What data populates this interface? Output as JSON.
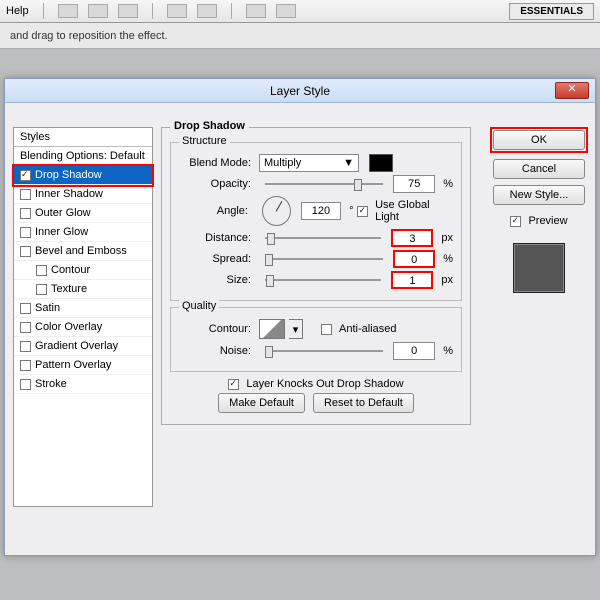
{
  "menubar": {
    "help": "Help"
  },
  "essentials_label": "ESSENTIALS",
  "optionsbar_hint": "and drag to reposition the effect.",
  "dialog": {
    "title": "Layer Style",
    "close_glyph": "✕"
  },
  "styles": {
    "header": "Styles",
    "blending": "Blending Options: Default",
    "items": [
      {
        "label": "Drop Shadow",
        "checked": true,
        "selected": true
      },
      {
        "label": "Inner Shadow",
        "checked": false
      },
      {
        "label": "Outer Glow",
        "checked": false
      },
      {
        "label": "Inner Glow",
        "checked": false
      },
      {
        "label": "Bevel and Emboss",
        "checked": false
      },
      {
        "label": "Contour",
        "checked": false,
        "sub": true
      },
      {
        "label": "Texture",
        "checked": false,
        "sub": true
      },
      {
        "label": "Satin",
        "checked": false
      },
      {
        "label": "Color Overlay",
        "checked": false
      },
      {
        "label": "Gradient Overlay",
        "checked": false
      },
      {
        "label": "Pattern Overlay",
        "checked": false
      },
      {
        "label": "Stroke",
        "checked": false
      }
    ]
  },
  "panel": {
    "group_label": "Drop Shadow",
    "structure": {
      "label": "Structure",
      "blend_mode_label": "Blend Mode:",
      "blend_mode_value": "Multiply",
      "opacity_label": "Opacity:",
      "opacity_value": "75",
      "angle_label": "Angle:",
      "angle_value": "120",
      "angle_unit": "°",
      "use_global_label": "Use Global Light",
      "distance_label": "Distance:",
      "distance_value": "3",
      "spread_label": "Spread:",
      "spread_value": "0",
      "size_label": "Size:",
      "size_value": "1",
      "px": "px",
      "pct": "%"
    },
    "quality": {
      "label": "Quality",
      "contour_label": "Contour:",
      "anti_aliased_label": "Anti-aliased",
      "noise_label": "Noise:",
      "noise_value": "0",
      "pct": "%"
    },
    "knocks_out_label": "Layer Knocks Out Drop Shadow",
    "make_default": "Make Default",
    "reset_default": "Reset to Default"
  },
  "right": {
    "ok": "OK",
    "cancel": "Cancel",
    "new_style": "New Style...",
    "preview": "Preview"
  }
}
